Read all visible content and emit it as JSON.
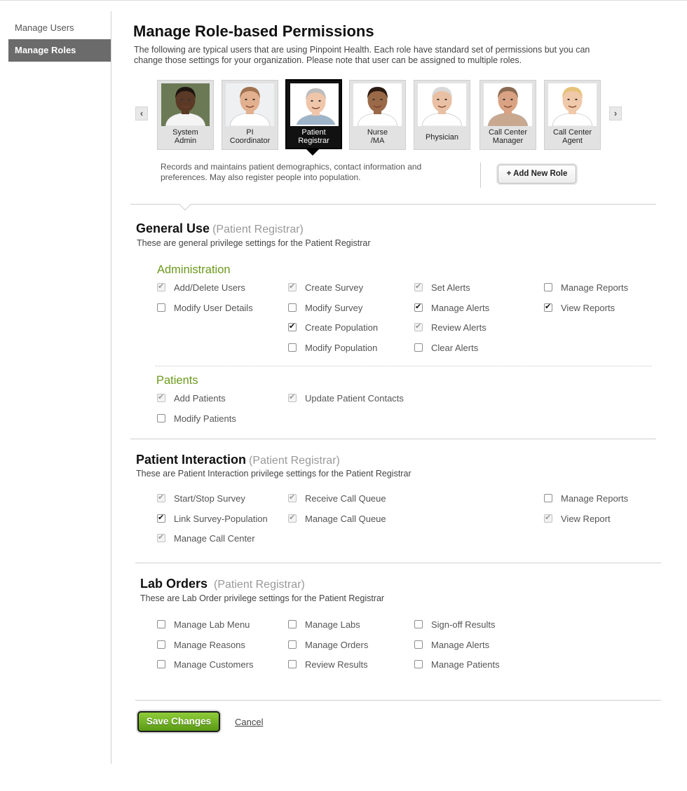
{
  "sidebar": {
    "items": [
      {
        "label": "Manage Users"
      },
      {
        "label": "Manage Roles"
      }
    ]
  },
  "header": {
    "title": "Manage Role-based Permissions",
    "description": "The following are typical users that are using Pinpoint Health.  Each role have standard set of permissions but you can change those settings for your organization. Please note that user can be assigned to multiple roles."
  },
  "roles": {
    "prev_icon": "‹",
    "next_icon": "›",
    "items": [
      {
        "line1": "System",
        "line2": "Admin",
        "skin": "#5a3a26",
        "hair": "#1e1510",
        "shirt": "#f4f4f4",
        "bg": "#6b7a55"
      },
      {
        "line1": "PI",
        "line2": "Coordinator",
        "skin": "#e2b08f",
        "hair": "#a07250",
        "shirt": "#ffffff",
        "bg": "#eef0f2"
      },
      {
        "line1": "Patient",
        "line2": "Registrar",
        "skin": "#efc6aa",
        "hair": "#bdbdbd",
        "shirt": "#9eb4c9",
        "bg": "#ffffff"
      },
      {
        "line1": "Nurse",
        "line2": "/MA",
        "skin": "#9a6a48",
        "hair": "#2b1b12",
        "shirt": "#ffffff",
        "bg": "#ffffff"
      },
      {
        "line1": "Physician",
        "line2": "",
        "skin": "#e9c0a3",
        "hair": "#d9d9d9",
        "shirt": "#ffffff",
        "bg": "#ffffff"
      },
      {
        "line1": "Call Center",
        "line2": "Manager",
        "skin": "#d9a283",
        "hair": "#8b6a52",
        "shirt": "#c9a890",
        "bg": "#ffffff"
      },
      {
        "line1": "Call Center",
        "line2": "Agent",
        "skin": "#f0c9aa",
        "hair": "#e7c27a",
        "shirt": "#ffffff",
        "bg": "#ffffff"
      }
    ],
    "selected_description": "Records and maintains patient demographics, contact information and preferences. May also register people into population.",
    "add_label": "+ Add New Role"
  },
  "general": {
    "title": "General Use",
    "role": "(Patient Registrar)",
    "subtitle": "These are general privilege settings for the Patient Registrar",
    "admin_title": "Administration",
    "admin": [
      {
        "label": "Add/Delete Users",
        "state": "dim"
      },
      {
        "label": "Modify User Details",
        "state": "off"
      },
      {
        "label": "Create Survey",
        "state": "dim"
      },
      {
        "label": "Modify Survey",
        "state": "off"
      },
      {
        "label": "Create Population",
        "state": "on"
      },
      {
        "label": "Modify Population",
        "state": "off"
      },
      {
        "label": "Set Alerts",
        "state": "dim"
      },
      {
        "label": "Manage Alerts",
        "state": "on"
      },
      {
        "label": "Review Alerts",
        "state": "dim"
      },
      {
        "label": "Clear Alerts",
        "state": "off"
      },
      {
        "label": "Manage Reports",
        "state": "off"
      },
      {
        "label": "View Reports",
        "state": "on"
      }
    ],
    "patients_title": "Patients",
    "patients": [
      {
        "label": "Add Patients",
        "state": "dim"
      },
      {
        "label": "Modify Patients",
        "state": "off"
      },
      {
        "label": "Update Patient Contacts",
        "state": "dim"
      }
    ]
  },
  "interaction": {
    "title": "Patient Interaction",
    "role": "(Patient Registrar)",
    "subtitle": "These are Patient Interaction privilege settings for the Patient Registrar",
    "items": [
      {
        "label": "Start/Stop Survey",
        "state": "dim"
      },
      {
        "label": "Link Survey-Population",
        "state": "on"
      },
      {
        "label": "Manage Call Center",
        "state": "dim"
      },
      {
        "label": "Receive Call Queue",
        "state": "dim"
      },
      {
        "label": "Manage Call Queue",
        "state": "dim"
      },
      {
        "label": "Manage Reports",
        "state": "off"
      },
      {
        "label": "View Report",
        "state": "dim"
      }
    ]
  },
  "lab": {
    "title": "Lab Orders",
    "role": "(Patient Registrar)",
    "subtitle": "These are Lab Order privilege settings for the Patient Registrar",
    "items": [
      {
        "label": "Manage Lab Menu",
        "state": "off"
      },
      {
        "label": "Manage Reasons",
        "state": "off"
      },
      {
        "label": "Manage Customers",
        "state": "off"
      },
      {
        "label": "Manage Labs",
        "state": "off"
      },
      {
        "label": "Manage Orders",
        "state": "off"
      },
      {
        "label": "Review Results",
        "state": "off"
      },
      {
        "label": "Sign-off Results",
        "state": "off"
      },
      {
        "label": "Manage Alerts",
        "state": "off"
      },
      {
        "label": "Manage Patients",
        "state": "off"
      }
    ]
  },
  "footer": {
    "save_label": "Save Changes",
    "cancel_label": "Cancel"
  }
}
